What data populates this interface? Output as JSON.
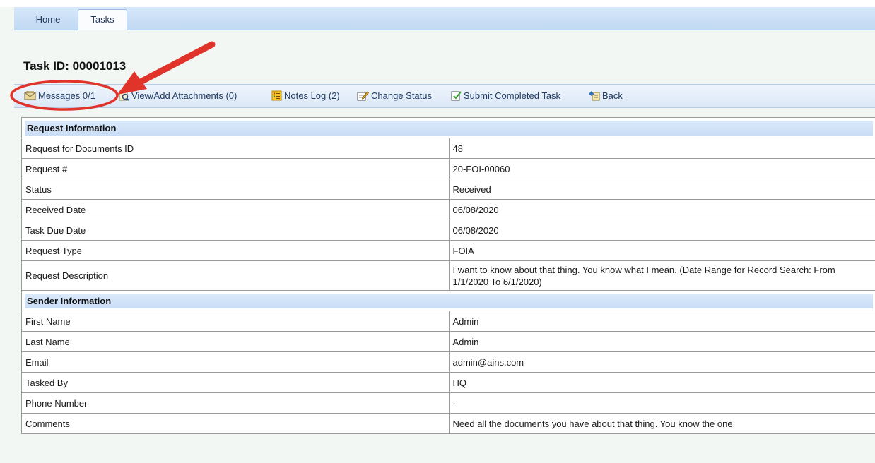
{
  "tabs": [
    {
      "label": "Home",
      "active": false
    },
    {
      "label": "Tasks",
      "active": true
    }
  ],
  "page_title": "Task ID: 00001013",
  "toolbar": {
    "messages": "Messages 0/1",
    "attachments": "View/Add Attachments (0)",
    "notes": "Notes Log (2)",
    "change_status": "Change Status",
    "submit": "Submit Completed Task",
    "back": "Back"
  },
  "request_section": {
    "header": "Request Information",
    "rows": [
      {
        "label": "Request for Documents ID",
        "value": "48"
      },
      {
        "label": "Request #",
        "value": "20-FOI-00060"
      },
      {
        "label": "Status",
        "value": "Received"
      },
      {
        "label": "Received Date",
        "value": "06/08/2020"
      },
      {
        "label": "Task Due Date",
        "value": "06/08/2020"
      },
      {
        "label": "Request Type",
        "value": "FOIA"
      },
      {
        "label": "Request Description",
        "value": "I want to know about that thing. You know what I mean. (Date Range for Record Search: From 1/1/2020 To 6/1/2020)"
      }
    ]
  },
  "sender_section": {
    "header": "Sender Information",
    "rows": [
      {
        "label": "First Name",
        "value": "Admin"
      },
      {
        "label": "Last Name",
        "value": "Admin"
      },
      {
        "label": "Email",
        "value": "admin@ains.com"
      },
      {
        "label": "Tasked By",
        "value": "HQ"
      },
      {
        "label": "Phone Number",
        "value": "-"
      },
      {
        "label": "Comments",
        "value": "Need all the documents you have about that thing. You know the one."
      }
    ]
  },
  "icons": [
    "messages-icon",
    "attachments-icon",
    "notes-icon",
    "change-status-icon",
    "submit-icon",
    "back-icon"
  ],
  "colors": {
    "tab_bar": "#c9ddf6",
    "annotation": "#e0332a",
    "toolbar_text": "#1f3b63"
  }
}
